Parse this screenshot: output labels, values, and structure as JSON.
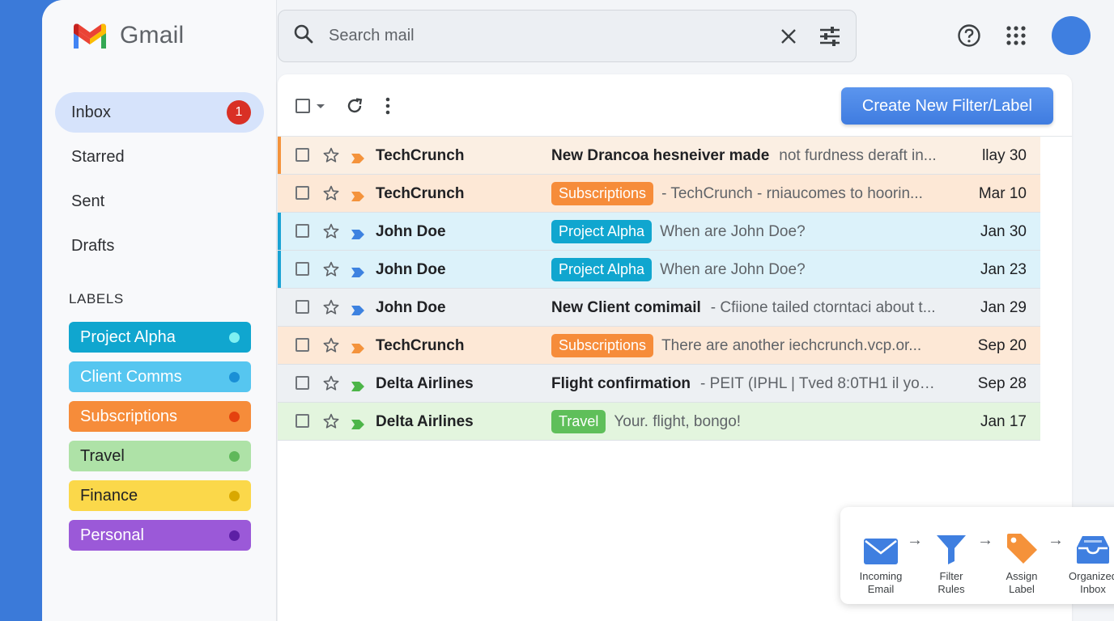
{
  "brand": {
    "name": "Gmail"
  },
  "nav": [
    {
      "label": "Inbox",
      "badge": "1",
      "active": true
    },
    {
      "label": "Starred"
    },
    {
      "label": "Sent"
    },
    {
      "label": "Drafts"
    }
  ],
  "labels": {
    "heading": "LABELS",
    "items": [
      {
        "label": "Project Alpha",
        "bg": "#10a6cf",
        "fg": "#ffffff",
        "dot": "#7ff0f2"
      },
      {
        "label": "Client Comms",
        "bg": "#56c6f0",
        "fg": "#ffffff",
        "dot": "#1a8fd6"
      },
      {
        "label": "Subscriptions",
        "bg": "#f68c3a",
        "fg": "#ffffff",
        "dot": "#e4420f"
      },
      {
        "label": "Travel",
        "bg": "#aee2a7",
        "fg": "#202124",
        "dot": "#5fb85a"
      },
      {
        "label": "Finance",
        "bg": "#fbd84a",
        "fg": "#202124",
        "dot": "#d9a800"
      },
      {
        "label": "Personal",
        "bg": "#9b59d8",
        "fg": "#ffffff",
        "dot": "#5d1fa5"
      }
    ]
  },
  "search": {
    "placeholder": "Search mail"
  },
  "toolbar": {
    "create_label": "Create New Filter/Label"
  },
  "emails": [
    {
      "sender": "TechCrunch",
      "tag": "",
      "subject": "New Drancoa hesneiver made",
      "snippet": "not furdness deraft in...",
      "date": "llay 30",
      "bg": "#fbefe3",
      "bar": "#f4933c",
      "imp": "#f4933c"
    },
    {
      "sender": "TechCrunch",
      "tag": "Subscriptions",
      "tagColor": "#f68c3a",
      "subject": "",
      "snippet": "- TechCrunch - rniaucomes to hoorin...",
      "date": "Mar 10",
      "bg": "#fde8d6",
      "bar": "",
      "imp": "#f4933c"
    },
    {
      "sender": "John Doe",
      "tag": "Project Alpha",
      "tagColor": "#10a6cf",
      "subject": "",
      "snippet": "When are John Doe?",
      "date": "Jan 30",
      "bg": "#dcf2fa",
      "bar": "#1aa3d4",
      "imp": "#3d82e0"
    },
    {
      "sender": "John Doe",
      "tag": "Project Alpha",
      "tagColor": "#10a6cf",
      "subject": "",
      "snippet": "When are John Doe?",
      "date": "Jan 23",
      "bg": "#dcf2fa",
      "bar": "#1aa3d4",
      "imp": "#3d82e0"
    },
    {
      "sender": "John Doe",
      "tag": "",
      "subject": "New Client comimail",
      "snippet": "- Cfiione tailed ctorntaci about t...",
      "date": "Jan 29",
      "bg": "#edf0f3",
      "bar": "",
      "imp": "#3d82e0"
    },
    {
      "sender": "TechCrunch",
      "tag": "Subscriptions",
      "tagColor": "#f68c3a",
      "subject": "",
      "snippet": "There are another iechcrunch.vcp.or...",
      "date": "Sep 20",
      "bg": "#fde8d6",
      "bar": "",
      "imp": "#f4933c"
    },
    {
      "sender": "Delta Airlines",
      "tag": "",
      "subject": "Flight confirmation",
      "snippet": "- PEIT (IPHL | Tved 8:0TH1 il you...",
      "date": "Sep 28",
      "bg": "#edf0f3",
      "bar": "",
      "imp": "#4cb548"
    },
    {
      "sender": "Delta Airlines",
      "tag": "Travel",
      "tagColor": "#5fbf5a",
      "subject": "",
      "snippet": "Your. flight, bongo!",
      "date": "Jan 17",
      "bg": "#e3f5de",
      "bar": "",
      "imp": "#4cb548"
    }
  ],
  "flow": [
    {
      "label1": "Incoming",
      "label2": "Email",
      "icon": "envelope-icon"
    },
    {
      "label1": "Filter",
      "label2": "Rules",
      "icon": "funnel-icon"
    },
    {
      "label1": "Assign",
      "label2": "Label",
      "icon": "tag-icon"
    },
    {
      "label1": "Organized",
      "label2": "Inbox",
      "icon": "inbox-tray-icon"
    }
  ]
}
